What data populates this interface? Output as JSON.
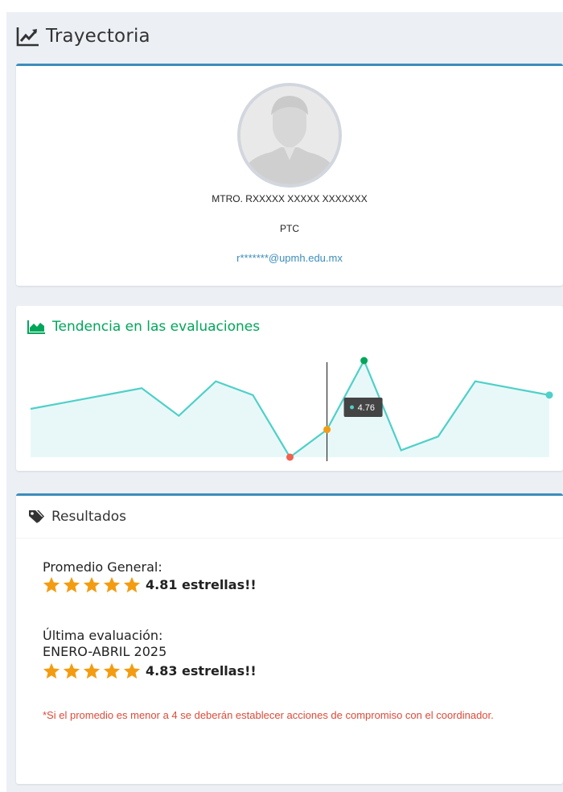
{
  "header": {
    "title": "Trayectoria",
    "icon": "line-chart-icon"
  },
  "profile": {
    "name": "MTRO. RXXXXX XXXXX XXXXXXX",
    "role": "PTC",
    "email": "r*******@upmh.edu.mx",
    "avatar": "user-avatar-placeholder"
  },
  "trend": {
    "title": "Tendencia en las evaluaciones",
    "icon": "area-chart-icon",
    "tooltip_value": "4.76",
    "colors": {
      "line": "#4fd0c8",
      "fill": "#e8f8f8",
      "min": "#f0624d",
      "max": "#00a65a",
      "highlight": "#f39c12",
      "last": "#4fd0c8"
    }
  },
  "chart_data": {
    "type": "line",
    "values": [
      4.79,
      4.8,
      4.81,
      4.82,
      4.78,
      4.83,
      4.81,
      4.72,
      4.76,
      4.86,
      4.73,
      4.75,
      4.83,
      4.82,
      4.81
    ],
    "ylim": [
      4.72,
      4.86
    ],
    "highlighted_index": 8,
    "tooltip": "4.76"
  },
  "results": {
    "title": "Resultados",
    "icon": "tags-icon",
    "general_label": "Promedio General:",
    "general_score": "4.81 estrellas!!",
    "general_stars": 5,
    "last_label": "Última evaluación:",
    "last_period": "ENERO-ABRIL 2025",
    "last_score": "4.83 estrellas!!",
    "last_stars": 5,
    "note": "*Si el promedio es menor a 4 se deberán establecer acciones de compromiso con el coordinador.",
    "star_color": "#f39c12"
  }
}
